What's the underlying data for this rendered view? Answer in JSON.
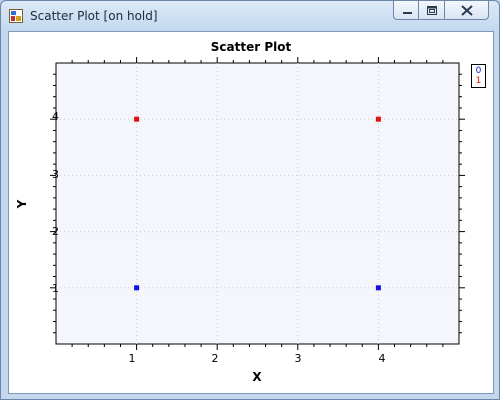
{
  "window": {
    "title": "Scatter Plot [on hold]",
    "icons": {
      "app": "chart-app-icon",
      "minimize": "minimize-icon",
      "maximize": "maximize-icon",
      "close": "close-icon"
    }
  },
  "chart_data": {
    "type": "scatter",
    "title": "Scatter Plot",
    "xlabel": "X",
    "ylabel": "Y",
    "xlim": [
      0,
      5
    ],
    "ylim": [
      0,
      5
    ],
    "x_ticks": [
      "1",
      "2",
      "3",
      "4"
    ],
    "y_ticks": [
      "1",
      "2",
      "3",
      "4"
    ],
    "grid": true,
    "legend_position": "top-right-outside",
    "series": [
      {
        "name": "0",
        "color": "#1010e0",
        "points": [
          [
            1,
            1
          ],
          [
            4,
            1
          ]
        ]
      },
      {
        "name": "1",
        "color": "#e01010",
        "points": [
          [
            1,
            4
          ],
          [
            4,
            4
          ]
        ]
      }
    ],
    "plot_background": "#f5f6fc"
  }
}
